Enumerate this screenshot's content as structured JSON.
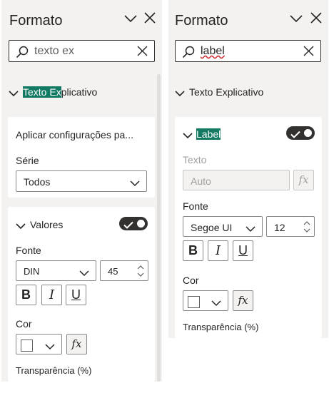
{
  "left": {
    "title": "Formato",
    "search_value": "texto ex",
    "section_title_highlight": "Texto Ex",
    "section_title_rest": "plicativo",
    "apply_card": {
      "label": "Aplicar configurações pa...",
      "series_label": "Série",
      "series_value": "Todos"
    },
    "values_card": {
      "title": "Valores",
      "toggle_on": true,
      "font_label": "Fonte",
      "font_value": "DIN",
      "size_value": "45",
      "bold": "B",
      "italic": "I",
      "underline": "U",
      "color_label": "Cor",
      "fx": "fx",
      "transparency_label": "Transparência (%)"
    }
  },
  "right": {
    "title": "Formato",
    "search_value": "label",
    "section_title": "Texto Explicativo",
    "label_card": {
      "title": "Label",
      "toggle_on": true,
      "text_label": "Texto",
      "text_value": "Auto",
      "fx": "fx",
      "font_label": "Fonte",
      "font_value": "Segoe UI",
      "size_value": "12",
      "bold": "B",
      "italic": "I",
      "underline": "U",
      "color_label": "Cor",
      "transparency_label": "Transparência (%)"
    }
  },
  "colors": {
    "highlight": "#127a63",
    "panel_bg": "#f3f2f1",
    "card_bg": "#ffffff",
    "toggle_bg": "#323130"
  }
}
